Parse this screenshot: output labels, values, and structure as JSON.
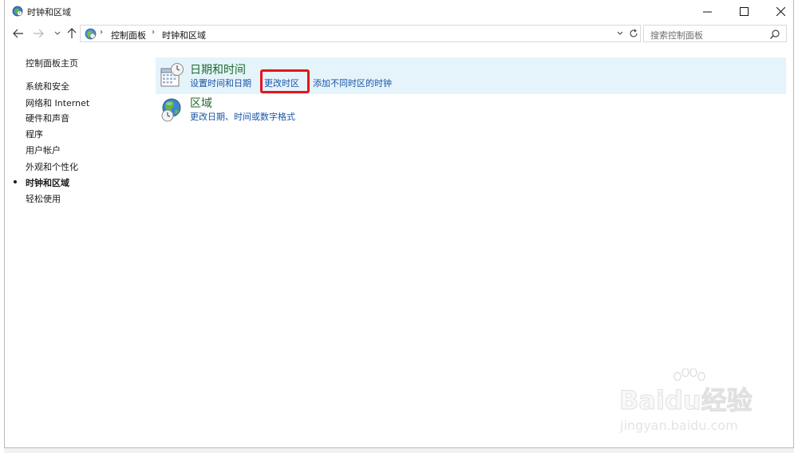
{
  "window": {
    "title": "时钟和区域"
  },
  "address": {
    "crumbs": [
      "控制面板",
      "时钟和区域"
    ],
    "search_placeholder": "搜索控制面板"
  },
  "sidebar": {
    "items": [
      {
        "label": "控制面板主页"
      },
      {
        "label": "系统和安全"
      },
      {
        "label": "网络和 Internet"
      },
      {
        "label": "硬件和声音"
      },
      {
        "label": "程序"
      },
      {
        "label": "用户帐户"
      },
      {
        "label": "外观和个性化"
      },
      {
        "label": "时钟和区域",
        "active": true
      },
      {
        "label": "轻松使用"
      }
    ]
  },
  "categories": [
    {
      "title": "日期和时间",
      "icon": "calendar-clock-icon",
      "links": [
        "设置时间和日期",
        "更改时区",
        "添加不同时区的时钟"
      ]
    },
    {
      "title": "区域",
      "icon": "globe-clock-icon",
      "links": [
        "更改日期、时间或数字格式"
      ]
    }
  ],
  "colors": {
    "link": "#1a55a8",
    "title": "#1e6b2a",
    "hover_bg": "#e5f3fb",
    "highlight": "#e3161b"
  },
  "watermark": {
    "logo": "Baidu经验",
    "url": "jingyan.baidu.com"
  }
}
